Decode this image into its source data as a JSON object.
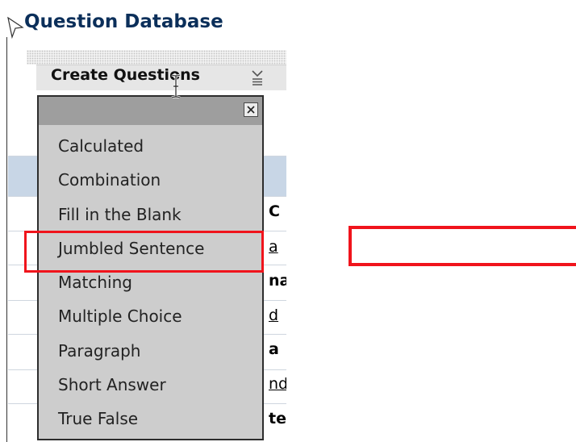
{
  "page": {
    "title": "Question Database"
  },
  "toolbar": {
    "create_label": "Create Questions"
  },
  "table_peek": [
    "C",
    "a",
    "na",
    "d",
    "a",
    "nd",
    "te"
  ],
  "dropdown": {
    "items": [
      {
        "label": "Calculated"
      },
      {
        "label": "Combination"
      },
      {
        "label": "Fill in the Blank"
      },
      {
        "label": "Jumbled Sentence"
      },
      {
        "label": "Matching"
      },
      {
        "label": "Multiple Choice"
      },
      {
        "label": "Paragraph"
      },
      {
        "label": "Short Answer"
      },
      {
        "label": "True False"
      }
    ]
  },
  "annotations": {
    "highlighted_item": "Jumbled Sentence",
    "color": "#f0141c"
  },
  "colors": {
    "title": "#0b2f5a",
    "row_highlight": "#c8d6e6",
    "menu_bg": "#cdcdcd"
  },
  "icons": [
    "heading-arrow-icon",
    "menu-caret-icon",
    "close-icon",
    "text-cursor-icon"
  ]
}
